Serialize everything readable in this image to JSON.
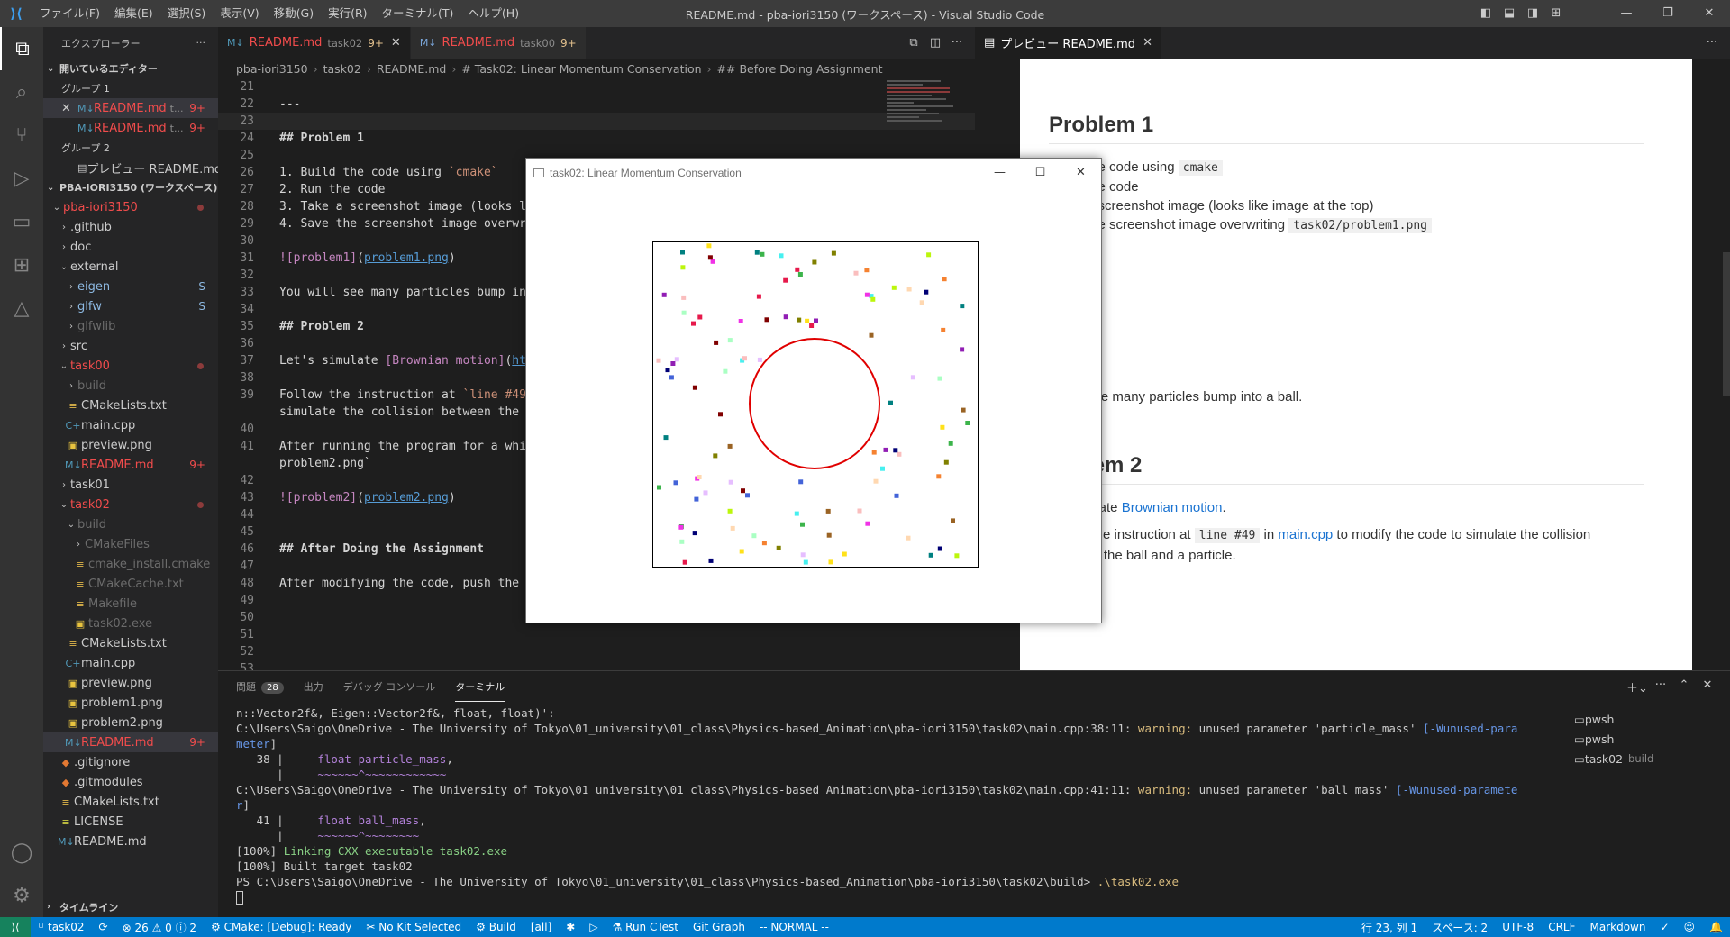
{
  "window": {
    "title": "README.md - pba-iori3150 (ワークスペース) - Visual Studio Code",
    "menu": [
      "ファイル(F)",
      "編集(E)",
      "選択(S)",
      "表示(V)",
      "移動(G)",
      "実行(R)",
      "ターミナル(T)",
      "ヘルプ(H)"
    ],
    "controls": [
      "—",
      "❐",
      "✕"
    ]
  },
  "activity_bar": [
    "explorer-icon",
    "search-icon",
    "source-control-icon",
    "run-debug-icon",
    "remote-explorer-icon",
    "extensions-icon",
    "cmake-icon",
    "account-icon",
    "gear-icon"
  ],
  "sidebar": {
    "title": "エクスプローラー",
    "open_editors_label": "開いているエディター",
    "group1": "グループ 1",
    "group2": "グループ 2",
    "open_editors": [
      {
        "name": "README.md",
        "desc": "t...",
        "badge": "9+"
      },
      {
        "name": "README.md",
        "desc": "t...",
        "badge": "9+"
      },
      {
        "name": "プレビュー README.md",
        "desc": "",
        "badge": ""
      }
    ],
    "workspace_label": "PBA-IORI3150 (ワークスペース)",
    "tree": [
      {
        "name": "pba-iori3150",
        "type": "folder-open",
        "depth": 0,
        "color": "err",
        "dot": true
      },
      {
        "name": ".github",
        "type": "folder",
        "depth": 1
      },
      {
        "name": "doc",
        "type": "folder",
        "depth": 1
      },
      {
        "name": "external",
        "type": "folder-open",
        "depth": 1
      },
      {
        "name": "eigen",
        "type": "folder",
        "depth": 2,
        "color": "sub",
        "badge": "S"
      },
      {
        "name": "glfw",
        "type": "folder",
        "depth": 2,
        "color": "sub",
        "badge": "S"
      },
      {
        "name": "glfwlib",
        "type": "folder",
        "depth": 2,
        "color": "git"
      },
      {
        "name": "src",
        "type": "folder",
        "depth": 1
      },
      {
        "name": "task00",
        "type": "folder-open",
        "depth": 1,
        "color": "err",
        "dot": true
      },
      {
        "name": "build",
        "type": "folder",
        "depth": 2,
        "color": "git"
      },
      {
        "name": "CMakeLists.txt",
        "type": "txt",
        "depth": 2
      },
      {
        "name": "main.cpp",
        "type": "cpp",
        "depth": 2
      },
      {
        "name": "preview.png",
        "type": "png",
        "depth": 2
      },
      {
        "name": "README.md",
        "type": "md",
        "depth": 2,
        "color": "err",
        "badge": "9+"
      },
      {
        "name": "task01",
        "type": "folder",
        "depth": 1
      },
      {
        "name": "task02",
        "type": "folder-open",
        "depth": 1,
        "color": "err",
        "dot": true
      },
      {
        "name": "build",
        "type": "folder-open",
        "depth": 2,
        "color": "git"
      },
      {
        "name": "CMakeFiles",
        "type": "folder",
        "depth": 3,
        "color": "git"
      },
      {
        "name": "cmake_install.cmake",
        "type": "txt",
        "depth": 3,
        "color": "git"
      },
      {
        "name": "CMakeCache.txt",
        "type": "txt",
        "depth": 3,
        "color": "git"
      },
      {
        "name": "Makefile",
        "type": "txt",
        "depth": 3,
        "color": "git"
      },
      {
        "name": "task02.exe",
        "type": "exe",
        "depth": 3,
        "color": "git"
      },
      {
        "name": "CMakeLists.txt",
        "type": "txt",
        "depth": 2
      },
      {
        "name": "main.cpp",
        "type": "cpp",
        "depth": 2
      },
      {
        "name": "preview.png",
        "type": "png",
        "depth": 2
      },
      {
        "name": "problem1.png",
        "type": "png",
        "depth": 2
      },
      {
        "name": "problem2.png",
        "type": "png",
        "depth": 2
      },
      {
        "name": "README.md",
        "type": "md",
        "depth": 2,
        "color": "err",
        "badge": "9+",
        "selected": true
      },
      {
        "name": ".gitignore",
        "type": "git",
        "depth": 1
      },
      {
        "name": ".gitmodules",
        "type": "git",
        "depth": 1
      },
      {
        "name": "CMakeLists.txt",
        "type": "txt",
        "depth": 1
      },
      {
        "name": "LICENSE",
        "type": "lic",
        "depth": 1
      },
      {
        "name": "README.md",
        "type": "md",
        "depth": 1
      }
    ],
    "timeline_label": "タイムライン"
  },
  "editor": {
    "tabs": [
      {
        "label": "README.md",
        "desc": "task02",
        "badge": "9+",
        "active": true
      },
      {
        "label": "README.md",
        "desc": "task00",
        "badge": "9+",
        "active": false
      }
    ],
    "breadcrumb": [
      "pba-iori3150",
      "task02",
      "README.md",
      "# Task02: Linear Momentum Conservation",
      "## Before Doing Assignment"
    ],
    "lines": [
      {
        "n": "21",
        "t": ""
      },
      {
        "n": "22",
        "t": "---"
      },
      {
        "n": "23",
        "t": "",
        "cur": true
      },
      {
        "n": "24",
        "t": "## Problem 1",
        "h": true
      },
      {
        "n": "25",
        "t": ""
      },
      {
        "n": "26",
        "t": "1. Build the code using `cmake`"
      },
      {
        "n": "27",
        "t": "2. Run the code"
      },
      {
        "n": "28",
        "t": "3. Take a screenshot image (looks li"
      },
      {
        "n": "29",
        "t": "4. Save the screenshot image overwri"
      },
      {
        "n": "30",
        "t": ""
      },
      {
        "n": "31",
        "t": "![problem1](problem1.png)"
      },
      {
        "n": "32",
        "t": ""
      },
      {
        "n": "33",
        "t": "You will see many particles bump int"
      },
      {
        "n": "34",
        "t": ""
      },
      {
        "n": "35",
        "t": "## Problem 2",
        "h": true
      },
      {
        "n": "36",
        "t": ""
      },
      {
        "n": "37",
        "t": "Let's simulate [Brownian motion](htt"
      },
      {
        "n": "38",
        "t": ""
      },
      {
        "n": "39",
        "t": "Follow the instruction at `line #49`"
      },
      {
        "n": "",
        "t": "simulate the collision between the b"
      },
      {
        "n": "40",
        "t": ""
      },
      {
        "n": "41",
        "t": "After running the program for a whil"
      },
      {
        "n": "",
        "t": "problem2.png`",
        "err": true
      },
      {
        "n": "42",
        "t": ""
      },
      {
        "n": "43",
        "t": "![problem2](problem2.png)"
      },
      {
        "n": "44",
        "t": ""
      },
      {
        "n": "45",
        "t": ""
      },
      {
        "n": "46",
        "t": "## After Doing the Assignment",
        "h": true
      },
      {
        "n": "47",
        "t": ""
      },
      {
        "n": "48",
        "t": "After modifying the code, push the c"
      },
      {
        "n": "49",
        "t": ""
      },
      {
        "n": "50",
        "t": ""
      },
      {
        "n": "51",
        "t": ""
      },
      {
        "n": "52",
        "t": ""
      },
      {
        "n": "53",
        "t": ""
      }
    ]
  },
  "preview": {
    "tab_label": "プレビュー README.md",
    "problem1_heading": "Problem 1",
    "p1_lines": [
      {
        "pre": "the code using ",
        "code": "cmake",
        "post": ""
      },
      {
        "pre": "the code",
        "code": "",
        "post": ""
      },
      {
        "pre": "a screenshot image (looks like image at the top)",
        "code": "",
        "post": ""
      },
      {
        "pre": "the screenshot image overwriting ",
        "code": "task02/problem1.png",
        "post": ""
      }
    ],
    "bump_text": "see many particles bump into a ball.",
    "problem2_heading": "lem 2",
    "p2_intro_pre": "ulate ",
    "p2_intro_link": "Brownian motion",
    "p2_intro_post": ".",
    "follow_pre": "Follow the instruction at ",
    "follow_code": "line #49",
    "follow_mid": " in ",
    "follow_link": "main.cpp",
    "follow_post": " to modify the code to simulate the collision",
    "follow_line2": "between the ball and a particle."
  },
  "sim_window": {
    "title": "task02: Linear Momentum Conservation"
  },
  "panel": {
    "tabs": [
      {
        "label": "問題",
        "count": "28"
      },
      {
        "label": "出力"
      },
      {
        "label": "デバッグ コンソール"
      },
      {
        "label": "ターミナル",
        "active": true
      }
    ],
    "terminal_lines": [
      "n::Vector2f&, Eigen::Vector2f&, float, float)':",
      "C:\\Users\\Saigo\\OneDrive - The University of Tokyo\\01_university\\01_class\\Physics-based_Animation\\pba-iori3150\\task02\\main.cpp:38:11: warning: unused parameter 'particle_mass' [-Wunused-para",
      "meter]",
      "   38 |     float particle_mass,",
      "      |     ~~~~~~^~~~~~~~~~~~~",
      "C:\\Users\\Saigo\\OneDrive - The University of Tokyo\\01_university\\01_class\\Physics-based_Animation\\pba-iori3150\\task02\\main.cpp:41:11: warning: unused parameter 'ball_mass' [-Wunused-paramete",
      "r]",
      "   41 |     float ball_mass,",
      "      |     ~~~~~~^~~~~~~~~",
      "[100%] Linking CXX executable task02.exe",
      "[100%] Built target task02",
      "PS C:\\Users\\Saigo\\OneDrive - The University of Tokyo\\01_university\\01_class\\Physics-based_Animation\\pba-iori3150\\task02\\build> .\\task02.exe",
      ""
    ],
    "terminals": [
      {
        "name": "pwsh",
        "sub": ""
      },
      {
        "name": "pwsh",
        "sub": ""
      },
      {
        "name": "task02",
        "sub": "build"
      }
    ]
  },
  "statusbar": {
    "branch": "task02",
    "problems": "⊗ 26 ⚠ 0 ⓘ 2",
    "cmake": "CMake: [Debug]: Ready",
    "kit": "No Kit Selected",
    "build": "Build",
    "all": "[all]",
    "run_ctest": "Run CTest",
    "git_graph": "Git Graph",
    "mode": "-- NORMAL --",
    "position": "行 23, 列 1",
    "spaces": "スペース: 2",
    "encoding": "UTF-8",
    "eol": "CRLF",
    "language": "Markdown"
  }
}
